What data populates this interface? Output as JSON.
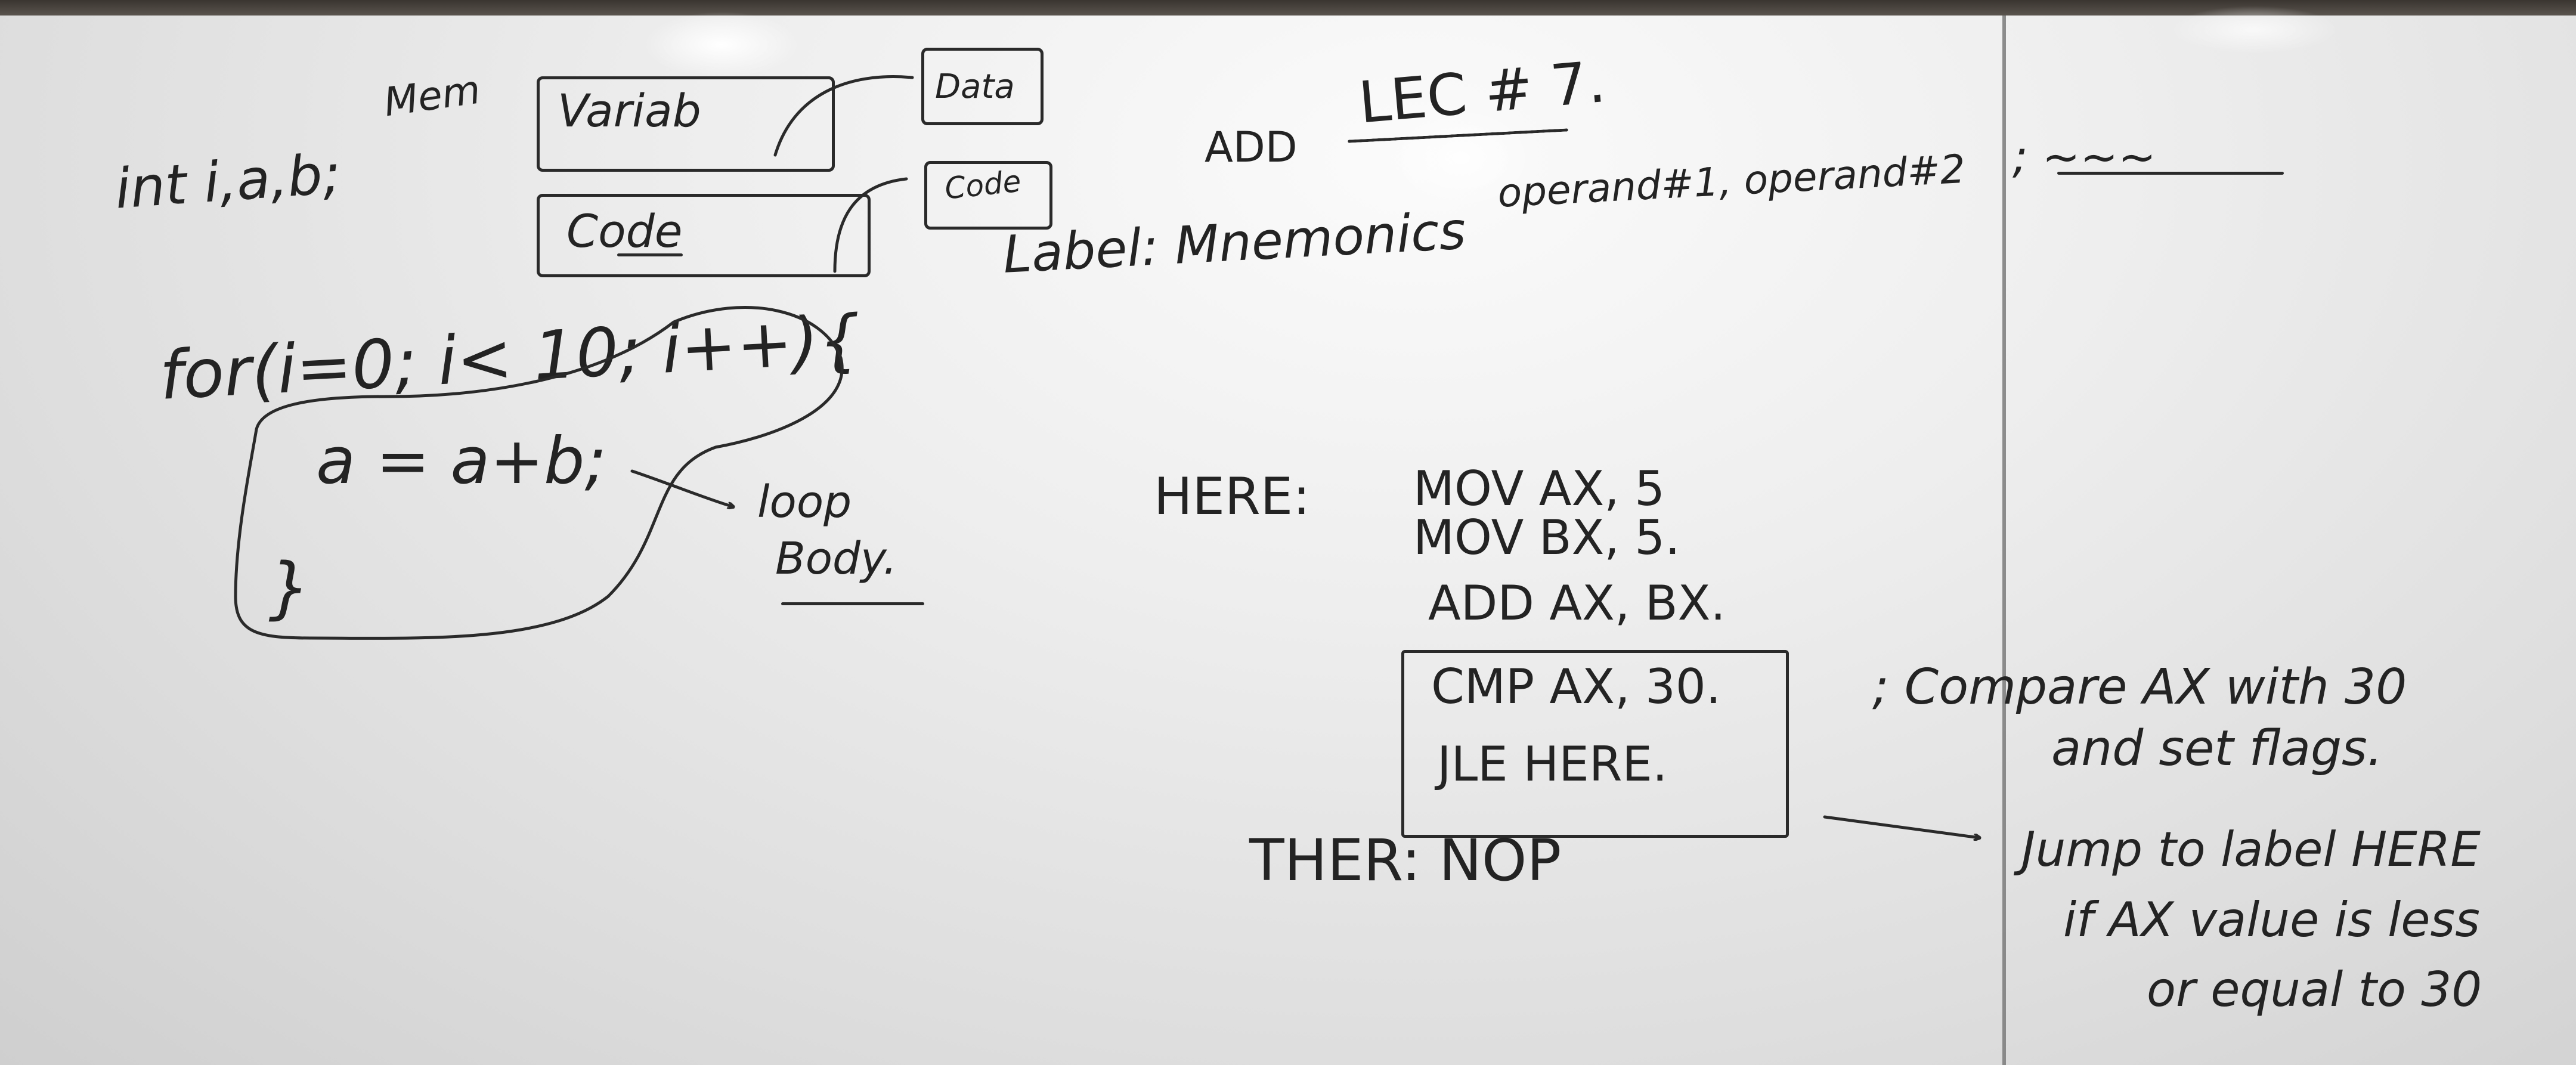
{
  "board": {
    "memory_label": "Mem",
    "variable_box": "Variab",
    "data_box": "Data",
    "code_box": "Code",
    "code_small_box": "Code",
    "declaration": "int i,a,b;",
    "for_statement": "for(i=0; i< 10; i++){",
    "loop_statement": "a = a+b;",
    "closing_brace": "}",
    "loop_body_label_1": "loop",
    "loop_body_label_2": "Body.",
    "lecture_add": "ADD",
    "lecture_title": "LEC # 7.",
    "syntax_label": "Label: Mnemonics",
    "syntax_operands": "operand#1, operand#2",
    "syntax_comment": "; ~~~",
    "asm_label_here": "HERE:",
    "asm_line_1": "MOV AX, 5",
    "asm_line_2": "MOV BX, 5.",
    "asm_line_3": "ADD AX, BX.",
    "asm_line_4": "CMP AX, 30.",
    "asm_line_5": "JLE HERE.",
    "asm_label_ther": "THER: NOP",
    "cmp_comment_1": "; Compare AX with 30",
    "cmp_comment_2": "and set flags.",
    "jle_comment_1": "Jump to label HERE",
    "jle_comment_2": "if AX value is less",
    "jle_comment_3": "or equal to 30"
  },
  "colors": {
    "ink": "#232323",
    "board": "#eeeeee",
    "frame": "#4a4540"
  }
}
